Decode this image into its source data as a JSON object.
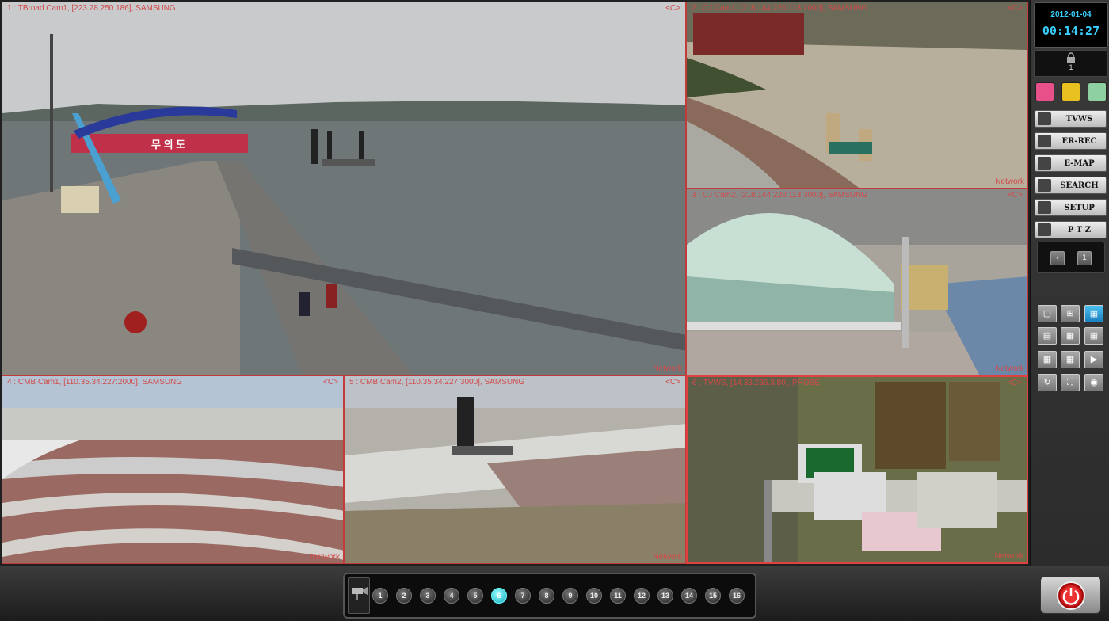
{
  "cameras": [
    {
      "title": "1 : TBroad Cam1, [223.28.250.186], SAMSUNG",
      "flag": "<C>",
      "net": "Network"
    },
    {
      "title": "2 : CJ Cam1, [218.144.220.113:2000], SAMSUNG",
      "flag": "<C>",
      "net": "Network"
    },
    {
      "title": "3 : CJ Cam2, [218.144.220.113:3000], SAMSUNG",
      "flag": "<C>",
      "net": "Network"
    },
    {
      "title": "4 : CMB Cam1, [110.35.34.227:2000], SAMSUNG",
      "flag": "<C>",
      "net": "Network"
    },
    {
      "title": "5 : CMB Cam2, [110.35.34.227:3000], SAMSUNG",
      "flag": "<C>",
      "net": "Network"
    },
    {
      "title": "6 : TVWS, [14.33.236.3:80], PROBE",
      "flag": "<C>",
      "net": "Network"
    }
  ],
  "gate_sign": "무 의 도",
  "clock": {
    "date": "2012-01-04",
    "time": "00:14:27"
  },
  "lock": {
    "number": "1"
  },
  "color_buttons": [
    "#e8508a",
    "#e8c020",
    "#8fd0a0"
  ],
  "menu": [
    {
      "label": "TVWS",
      "icon": "camera-icon"
    },
    {
      "label": "ER-REC",
      "icon": "recorder-icon"
    },
    {
      "label": "E-MAP",
      "icon": "globe-icon"
    },
    {
      "label": "SEARCH",
      "icon": "search-icon"
    },
    {
      "label": "SETUP",
      "icon": "tools-icon"
    },
    {
      "label": "P T Z",
      "icon": "ptz-icon"
    }
  ],
  "pager": {
    "prev": "‹",
    "page": "1"
  },
  "layout_buttons": [
    "▢",
    "⊞",
    "▦",
    "▤",
    "▦",
    "▦",
    "▦",
    "▦",
    "▶",
    "↻",
    "⛶",
    "◉"
  ],
  "channels": [
    "1",
    "2",
    "3",
    "4",
    "5",
    "6",
    "7",
    "8",
    "9",
    "10",
    "11",
    "12",
    "13",
    "14",
    "15",
    "16"
  ],
  "active_channel": "6"
}
